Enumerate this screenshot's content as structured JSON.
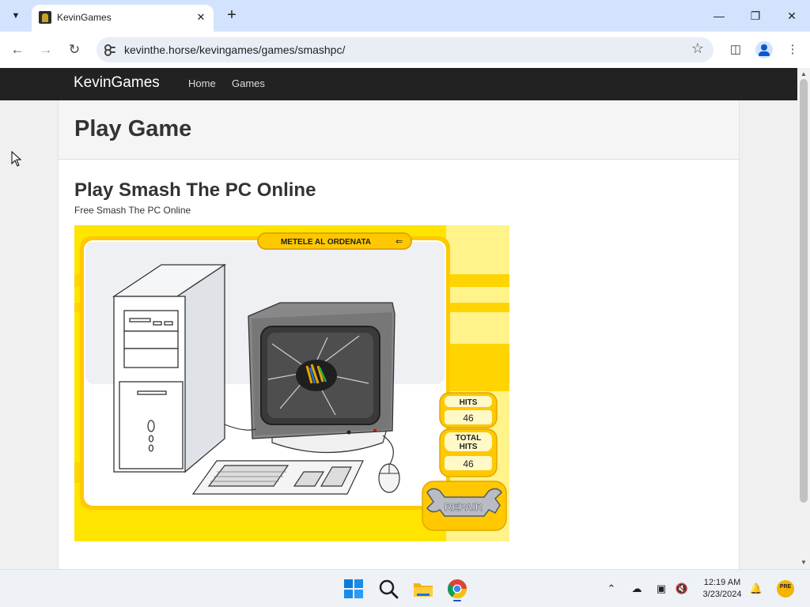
{
  "browser": {
    "tab_title": "KevinGames",
    "url": "kevinthe.horse/kevingames/games/smashpc/"
  },
  "site": {
    "brand": "KevinGames",
    "nav": [
      "Home",
      "Games"
    ],
    "page_title": "Play Game",
    "game_title": "Play Smash The PC Online",
    "game_subtitle": "Free Smash The PC Online"
  },
  "game": {
    "banner": "METELE AL ORDENATA",
    "hits_label": "HITS",
    "hits_value": "46",
    "total_label_1": "TOTAL",
    "total_label_2": "HITS",
    "total_value": "46",
    "repair_label": "REPAIR"
  },
  "taskbar": {
    "time": "12:19 AM",
    "date": "3/23/2024",
    "badge": "PRE"
  },
  "colors": {
    "game_yellow": "#ffe400",
    "navbar": "#222222",
    "accent": "#0b57d0"
  }
}
